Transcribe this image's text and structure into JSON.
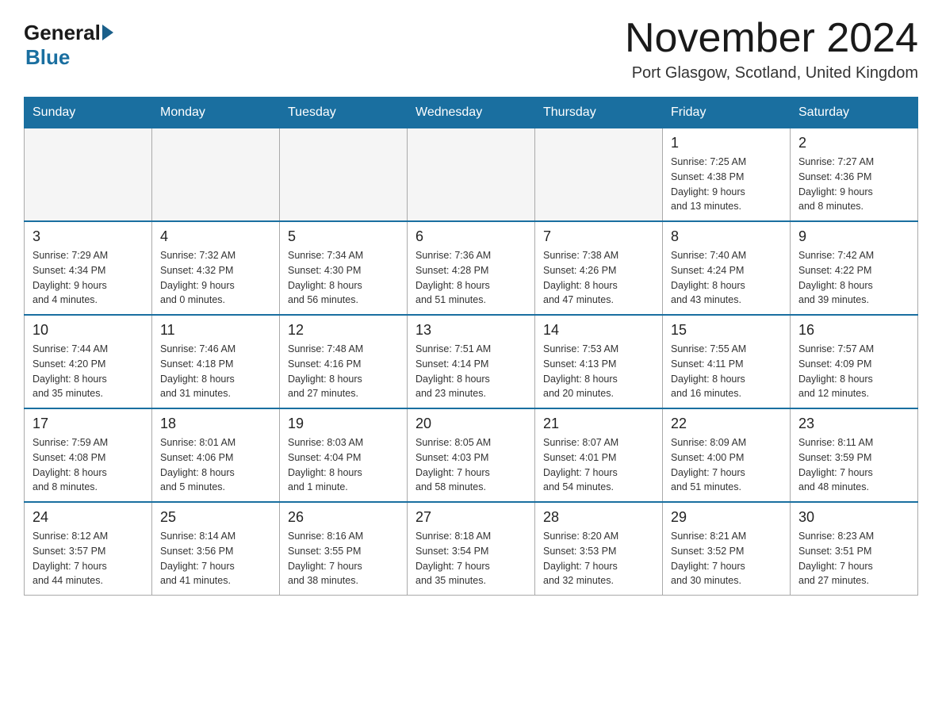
{
  "logo": {
    "general": "General",
    "blue": "Blue"
  },
  "header": {
    "title": "November 2024",
    "location": "Port Glasgow, Scotland, United Kingdom"
  },
  "days_of_week": [
    "Sunday",
    "Monday",
    "Tuesday",
    "Wednesday",
    "Thursday",
    "Friday",
    "Saturday"
  ],
  "weeks": [
    [
      {
        "day": "",
        "info": ""
      },
      {
        "day": "",
        "info": ""
      },
      {
        "day": "",
        "info": ""
      },
      {
        "day": "",
        "info": ""
      },
      {
        "day": "",
        "info": ""
      },
      {
        "day": "1",
        "info": "Sunrise: 7:25 AM\nSunset: 4:38 PM\nDaylight: 9 hours\nand 13 minutes."
      },
      {
        "day": "2",
        "info": "Sunrise: 7:27 AM\nSunset: 4:36 PM\nDaylight: 9 hours\nand 8 minutes."
      }
    ],
    [
      {
        "day": "3",
        "info": "Sunrise: 7:29 AM\nSunset: 4:34 PM\nDaylight: 9 hours\nand 4 minutes."
      },
      {
        "day": "4",
        "info": "Sunrise: 7:32 AM\nSunset: 4:32 PM\nDaylight: 9 hours\nand 0 minutes."
      },
      {
        "day": "5",
        "info": "Sunrise: 7:34 AM\nSunset: 4:30 PM\nDaylight: 8 hours\nand 56 minutes."
      },
      {
        "day": "6",
        "info": "Sunrise: 7:36 AM\nSunset: 4:28 PM\nDaylight: 8 hours\nand 51 minutes."
      },
      {
        "day": "7",
        "info": "Sunrise: 7:38 AM\nSunset: 4:26 PM\nDaylight: 8 hours\nand 47 minutes."
      },
      {
        "day": "8",
        "info": "Sunrise: 7:40 AM\nSunset: 4:24 PM\nDaylight: 8 hours\nand 43 minutes."
      },
      {
        "day": "9",
        "info": "Sunrise: 7:42 AM\nSunset: 4:22 PM\nDaylight: 8 hours\nand 39 minutes."
      }
    ],
    [
      {
        "day": "10",
        "info": "Sunrise: 7:44 AM\nSunset: 4:20 PM\nDaylight: 8 hours\nand 35 minutes."
      },
      {
        "day": "11",
        "info": "Sunrise: 7:46 AM\nSunset: 4:18 PM\nDaylight: 8 hours\nand 31 minutes."
      },
      {
        "day": "12",
        "info": "Sunrise: 7:48 AM\nSunset: 4:16 PM\nDaylight: 8 hours\nand 27 minutes."
      },
      {
        "day": "13",
        "info": "Sunrise: 7:51 AM\nSunset: 4:14 PM\nDaylight: 8 hours\nand 23 minutes."
      },
      {
        "day": "14",
        "info": "Sunrise: 7:53 AM\nSunset: 4:13 PM\nDaylight: 8 hours\nand 20 minutes."
      },
      {
        "day": "15",
        "info": "Sunrise: 7:55 AM\nSunset: 4:11 PM\nDaylight: 8 hours\nand 16 minutes."
      },
      {
        "day": "16",
        "info": "Sunrise: 7:57 AM\nSunset: 4:09 PM\nDaylight: 8 hours\nand 12 minutes."
      }
    ],
    [
      {
        "day": "17",
        "info": "Sunrise: 7:59 AM\nSunset: 4:08 PM\nDaylight: 8 hours\nand 8 minutes."
      },
      {
        "day": "18",
        "info": "Sunrise: 8:01 AM\nSunset: 4:06 PM\nDaylight: 8 hours\nand 5 minutes."
      },
      {
        "day": "19",
        "info": "Sunrise: 8:03 AM\nSunset: 4:04 PM\nDaylight: 8 hours\nand 1 minute."
      },
      {
        "day": "20",
        "info": "Sunrise: 8:05 AM\nSunset: 4:03 PM\nDaylight: 7 hours\nand 58 minutes."
      },
      {
        "day": "21",
        "info": "Sunrise: 8:07 AM\nSunset: 4:01 PM\nDaylight: 7 hours\nand 54 minutes."
      },
      {
        "day": "22",
        "info": "Sunrise: 8:09 AM\nSunset: 4:00 PM\nDaylight: 7 hours\nand 51 minutes."
      },
      {
        "day": "23",
        "info": "Sunrise: 8:11 AM\nSunset: 3:59 PM\nDaylight: 7 hours\nand 48 minutes."
      }
    ],
    [
      {
        "day": "24",
        "info": "Sunrise: 8:12 AM\nSunset: 3:57 PM\nDaylight: 7 hours\nand 44 minutes."
      },
      {
        "day": "25",
        "info": "Sunrise: 8:14 AM\nSunset: 3:56 PM\nDaylight: 7 hours\nand 41 minutes."
      },
      {
        "day": "26",
        "info": "Sunrise: 8:16 AM\nSunset: 3:55 PM\nDaylight: 7 hours\nand 38 minutes."
      },
      {
        "day": "27",
        "info": "Sunrise: 8:18 AM\nSunset: 3:54 PM\nDaylight: 7 hours\nand 35 minutes."
      },
      {
        "day": "28",
        "info": "Sunrise: 8:20 AM\nSunset: 3:53 PM\nDaylight: 7 hours\nand 32 minutes."
      },
      {
        "day": "29",
        "info": "Sunrise: 8:21 AM\nSunset: 3:52 PM\nDaylight: 7 hours\nand 30 minutes."
      },
      {
        "day": "30",
        "info": "Sunrise: 8:23 AM\nSunset: 3:51 PM\nDaylight: 7 hours\nand 27 minutes."
      }
    ]
  ]
}
